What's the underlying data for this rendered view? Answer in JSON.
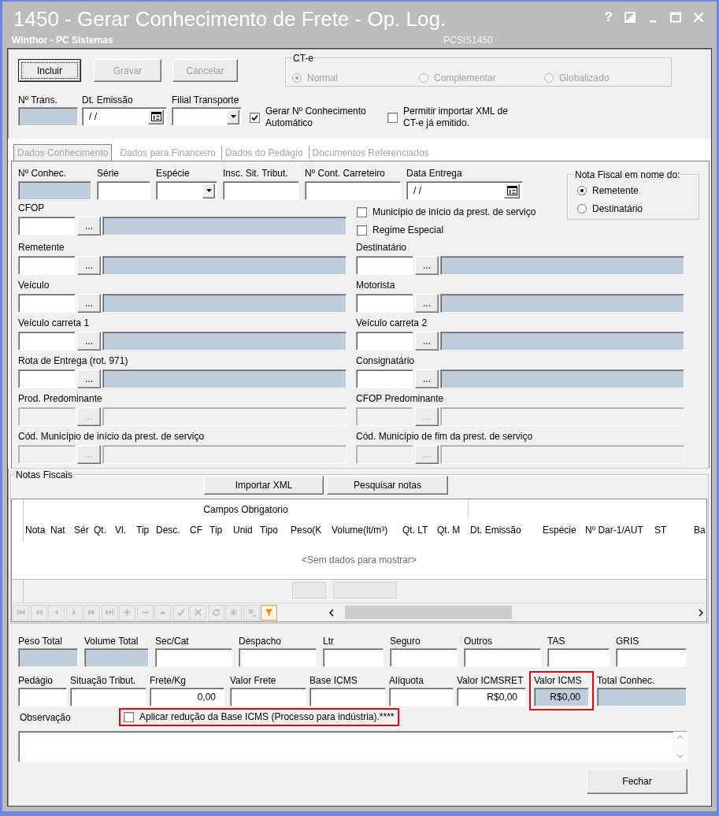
{
  "window": {
    "title": "1450 - Gerar Conhecimento de Frete - Op. Log.",
    "subtitle": "Winthor - PC Sistemas",
    "program_code": "PCSIS1450",
    "title_buttons": [
      {
        "kind": "help",
        "label": "?"
      },
      {
        "kind": "theme"
      },
      {
        "kind": "minimize"
      },
      {
        "kind": "maximize"
      },
      {
        "kind": "close"
      }
    ]
  },
  "actions": [
    {
      "label": "Incluir",
      "disabled": false,
      "focused": true
    },
    {
      "label": "Gravar",
      "disabled": true,
      "focused": false
    },
    {
      "label": "Cancelar",
      "disabled": true,
      "focused": false
    }
  ],
  "cte": {
    "title": "CT-e",
    "disabled": true,
    "options": [
      {
        "label": "Normal",
        "selected": true
      },
      {
        "label": "Complementar",
        "selected": false
      },
      {
        "label": "Globalizado",
        "selected": false
      }
    ]
  },
  "header_fields": [
    {
      "label": "Nº Trans.",
      "kind": "readonly"
    },
    {
      "label": "Dt. Emissão",
      "kind": "date",
      "value": "/ /"
    },
    {
      "label": "Filial Transporte",
      "kind": "select"
    }
  ],
  "header_checks": [
    {
      "label": "Gerar Nº Conhecimento Automático",
      "checked": true
    },
    {
      "label": "Permitir importar XML de CT-e já emitido.",
      "checked": false
    }
  ],
  "tabs": [
    {
      "label": "Dados Conhecimento",
      "selected": true,
      "disabled": true
    },
    {
      "label": "Dados para Financeiro",
      "selected": false,
      "disabled": true
    },
    {
      "label": "Dados do Pedágio",
      "selected": false,
      "disabled": true
    },
    {
      "label": "Documentos Referenciados",
      "selected": false,
      "disabled": true
    }
  ],
  "conhecimento_fields": [
    {
      "label": "Nº Conhec.",
      "kind": "readonly"
    },
    {
      "label": "Série",
      "kind": "text"
    },
    {
      "label": "Espécie",
      "kind": "select"
    },
    {
      "label": "Insc. Sit. Tribut.",
      "kind": "text"
    },
    {
      "label": "Nº Cont. Carreteiro",
      "kind": "text"
    },
    {
      "label": "Data Entrega",
      "kind": "date",
      "value": "/ /"
    }
  ],
  "nota_fiscal_em_nome": {
    "title": "Nota Fiscal em nome do:",
    "options": [
      {
        "label": "Remetente",
        "selected": true
      },
      {
        "label": "Destinatário",
        "selected": false
      }
    ]
  },
  "cfop": {
    "label": "CFOP",
    "button": "...",
    "disabled": false
  },
  "service_checks": [
    {
      "label": "Município de início da prest. de serviço",
      "checked": false
    },
    {
      "label": "Regime Especial",
      "checked": false
    }
  ],
  "lookup_rows": [
    [
      {
        "label": "Remetente",
        "button": "...",
        "disabled": false
      },
      {
        "label": "Destinatário",
        "button": "...",
        "disabled": false
      }
    ],
    [
      {
        "label": "Veículo",
        "button": "...",
        "disabled": false
      },
      {
        "label": "Motorista",
        "button": "...",
        "disabled": false
      }
    ],
    [
      {
        "label": "Veículo carreta 1",
        "button": "...",
        "disabled": false
      },
      {
        "label": "Veículo carreta 2",
        "button": "...",
        "disabled": false
      }
    ],
    [
      {
        "label": "Rota de Entrega (rot. 971)",
        "button": "...",
        "disabled": false
      },
      {
        "label": "Consignatário",
        "button": "...",
        "disabled": false
      }
    ],
    [
      {
        "label": "Prod. Predominante",
        "button": "...",
        "disabled": true
      },
      {
        "label": "CFOP Predominante",
        "button": "...",
        "disabled": true
      }
    ],
    [
      {
        "label": "Cód. Município de início da prest. de serviço",
        "button": "...",
        "disabled": true
      },
      {
        "label": "Cód. Município de fim da prest. de serviço",
        "button": "...",
        "disabled": true
      }
    ]
  ],
  "notas_fiscais": {
    "title": "Notas Fiscais",
    "buttons": [
      "Importar XML",
      "Pesquisar notas"
    ],
    "column_groups": [
      {
        "caption": "Campos Obrigatorio",
        "columns": [
          {
            "label": "Nota",
            "summary": false
          },
          {
            "label": "Nat",
            "summary": false
          },
          {
            "label": "Sér",
            "summary": false
          },
          {
            "label": "Qt.",
            "summary": false
          },
          {
            "label": "Vl.",
            "summary": false
          },
          {
            "label": "Tip",
            "summary": false
          },
          {
            "label": "Desc.",
            "summary": false
          },
          {
            "label": "CF",
            "summary": false
          },
          {
            "label": "Tip",
            "summary": false
          },
          {
            "label": "Unid",
            "summary": false
          },
          {
            "label": "Tipo",
            "summary": false
          },
          {
            "label": "Peso(K",
            "summary": true
          },
          {
            "label": "Volume(lt/m³)",
            "summary": true
          },
          {
            "label": "Qt. LT",
            "summary": false
          },
          {
            "label": "Qt. M",
            "summary": false
          }
        ]
      },
      {
        "columns": [
          {
            "label": "Dt. Emissão",
            "summary": false
          },
          {
            "label": "Espécie",
            "summary": false
          },
          {
            "label": "Nº Dar-1/AUT",
            "summary": false
          },
          {
            "label": "ST",
            "summary": false
          },
          {
            "label": "Ba",
            "summary": false
          }
        ]
      }
    ],
    "empty_text": "<Sem dados para mostrar>",
    "navigator": [
      {
        "kind": "first",
        "disabled": true
      },
      {
        "kind": "prevpage",
        "disabled": true
      },
      {
        "kind": "prev",
        "disabled": true
      },
      {
        "kind": "next",
        "disabled": true
      },
      {
        "kind": "nextpage",
        "disabled": true
      },
      {
        "kind": "last",
        "disabled": true
      },
      {
        "kind": "insert",
        "disabled": true
      },
      {
        "kind": "delete",
        "disabled": true
      },
      {
        "kind": "edit",
        "disabled": true
      },
      {
        "kind": "post",
        "disabled": true
      },
      {
        "kind": "cancel",
        "disabled": true
      },
      {
        "kind": "refresh",
        "disabled": true
      },
      {
        "kind": "bookmark",
        "disabled": true
      },
      {
        "kind": "gotobookmark",
        "disabled": true
      },
      {
        "kind": "filter",
        "disabled": false
      }
    ]
  },
  "totals_rows": [
    [
      {
        "label": "Peso Total",
        "kind": "readonly",
        "highlighted": false
      },
      {
        "label": "Volume Total",
        "kind": "readonly",
        "highlighted": false
      },
      {
        "label": "Sec/Cat",
        "kind": "text",
        "highlighted": false
      },
      {
        "label": "Despacho",
        "kind": "text",
        "highlighted": false
      },
      {
        "label": "Ltr",
        "kind": "text",
        "highlighted": false
      },
      {
        "label": "Seguro",
        "kind": "text",
        "highlighted": false
      },
      {
        "label": "Outros",
        "kind": "text",
        "highlighted": false
      },
      {
        "label": "TAS",
        "kind": "text",
        "highlighted": false
      },
      {
        "label": "GRIS",
        "kind": "text",
        "highlighted": false
      }
    ],
    [
      {
        "label": "Pedágio",
        "kind": "text",
        "highlighted": false
      },
      {
        "label": "Situação Tribut.",
        "kind": "text",
        "highlighted": false
      },
      {
        "label": "Frete/Kg",
        "kind": "text",
        "value": "0,00",
        "highlighted": false
      },
      {
        "label": "Valor Frete",
        "kind": "text",
        "highlighted": false
      },
      {
        "label": "Base ICMS",
        "kind": "text",
        "highlighted": false
      },
      {
        "label": "Alíquota",
        "kind": "text",
        "highlighted": false
      },
      {
        "label": "Valor ICMSRET",
        "kind": "text",
        "value": "R$0,00",
        "highlighted": false
      },
      {
        "label": "Valor ICMS",
        "kind": "readonly",
        "value": "R$0,00",
        "highlighted": true
      },
      {
        "label": "Total Conhec.",
        "kind": "readonly",
        "highlighted": false
      }
    ]
  ],
  "observacao": {
    "label": "Observação"
  },
  "reducao_check": {
    "label": "Aplicar redução da Base ICMS (Processo para indústria).****",
    "checked": false,
    "highlighted": true
  },
  "close_button": {
    "label": "Fechar"
  }
}
